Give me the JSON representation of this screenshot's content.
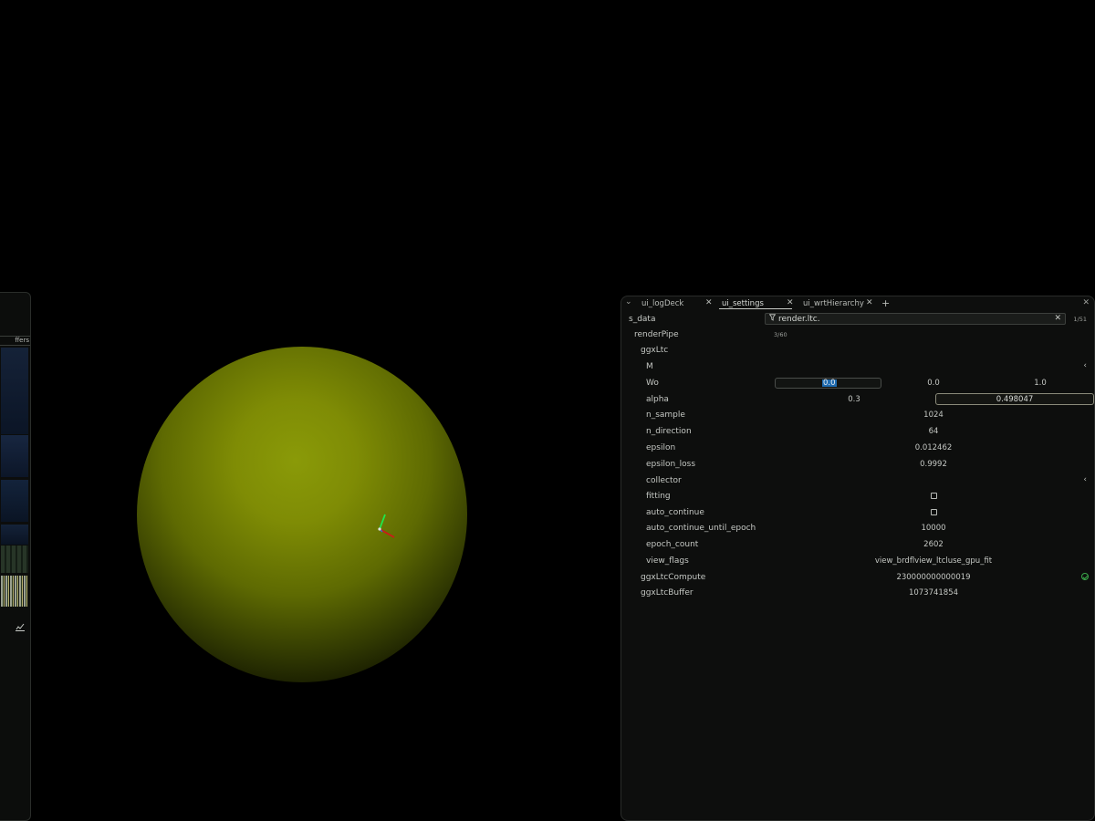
{
  "left_panel": {
    "tab_label": "ffers",
    "chart_icon": "chart-icon"
  },
  "viewport": {
    "sphere_color": "#7f8c05",
    "gizmo_axes": {
      "x": "#d01818",
      "y": "#1ee84a",
      "z": "#3a6ad0"
    }
  },
  "settings": {
    "tabs": [
      {
        "label": "ui_logDeck"
      },
      {
        "label": "ui_settings"
      },
      {
        "label": "ui_wrtHierarchy"
      }
    ],
    "active_tab": "ui_settings",
    "root_label": "s_data",
    "filter": {
      "value": "render.ltc.",
      "count": "1/51"
    },
    "rows": {
      "renderPipe": {
        "label": "renderPipe",
        "sub": "3/60"
      },
      "ggxLtc": {
        "label": "ggxLtc"
      },
      "M": {
        "label": "M"
      },
      "Wo": {
        "label": "Wo",
        "v0": "0.0",
        "v1": "0.0",
        "v2": "1.0"
      },
      "alpha": {
        "label": "alpha",
        "v0": "0.3",
        "v1": "0.498047"
      },
      "n_sample": {
        "label": "n_sample",
        "value": "1024"
      },
      "n_direction": {
        "label": "n_direction",
        "value": "64"
      },
      "epsilon": {
        "label": "epsilon",
        "value": "0.012462"
      },
      "epsilon_loss": {
        "label": "epsilon_loss",
        "value": "0.9992"
      },
      "collector": {
        "label": "collector"
      },
      "fitting": {
        "label": "fitting",
        "checked": false
      },
      "auto_continue": {
        "label": "auto_continue",
        "checked": false
      },
      "auto_continue_until_epoch": {
        "label": "auto_continue_until_epoch",
        "value": "10000"
      },
      "epoch_count": {
        "label": "epoch_count",
        "value": "2602"
      },
      "view_flags": {
        "label": "view_flags",
        "value": "view_brdfl​view_ltcluse_gpu_fit"
      },
      "ggxLtcCompute": {
        "label": "ggxLtcCompute",
        "value": "230000000000019"
      },
      "ggxLtcBuffer": {
        "label": "ggxLtcBuffer",
        "value": "1073741854"
      }
    }
  }
}
